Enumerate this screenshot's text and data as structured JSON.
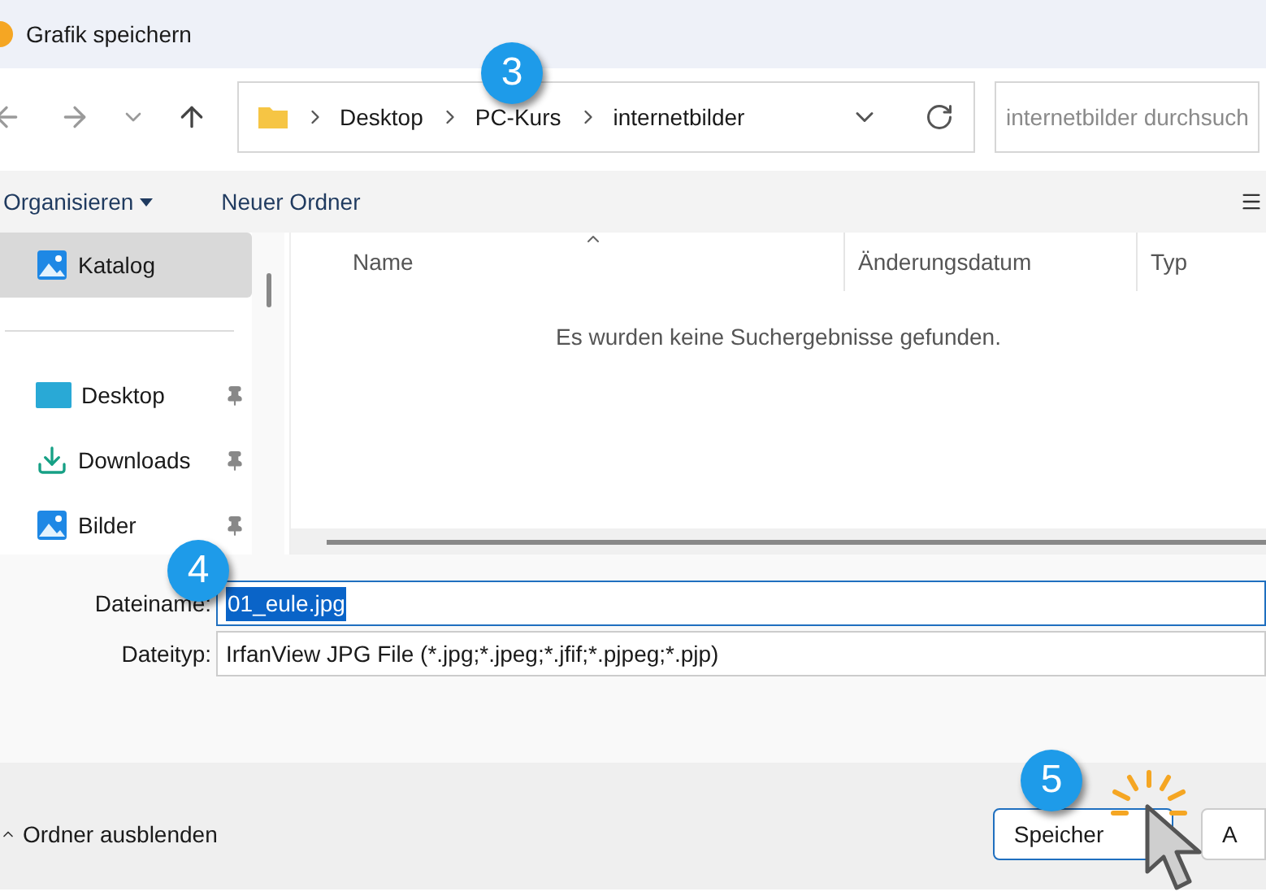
{
  "window": {
    "title": "Grafik speichern"
  },
  "address_bar": {
    "crumbs": [
      "Desktop",
      "PC-Kurs",
      "internetbilder"
    ]
  },
  "search": {
    "placeholder": "internetbilder durchsuch"
  },
  "toolbar": {
    "organize": "Organisieren",
    "new_folder": "Neuer Ordner"
  },
  "sidebar": {
    "items": [
      {
        "label": "Katalog",
        "kind": "picture",
        "pinned": false,
        "selected": true
      },
      {
        "label": "Desktop",
        "kind": "desktop",
        "pinned": true,
        "selected": false
      },
      {
        "label": "Downloads",
        "kind": "download",
        "pinned": true,
        "selected": false
      },
      {
        "label": "Bilder",
        "kind": "picture",
        "pinned": true,
        "selected": false
      }
    ]
  },
  "file_list": {
    "columns": [
      "Name",
      "Änderungsdatum",
      "Typ"
    ],
    "empty_message": "Es wurden keine Suchergebnisse gefunden."
  },
  "form": {
    "filename_label": "Dateiname:",
    "filename_value": "01_eule.jpg",
    "filetype_label": "Dateityp:",
    "filetype_value": "IrfanView JPG File (*.jpg;*.jpeg;*.jfif;*.pjpeg;*.pjp)"
  },
  "footer": {
    "hide_folders": "Ordner ausblenden",
    "buttons": [
      "Speicher",
      "A"
    ]
  },
  "callouts": [
    "3",
    "4",
    "5"
  ]
}
